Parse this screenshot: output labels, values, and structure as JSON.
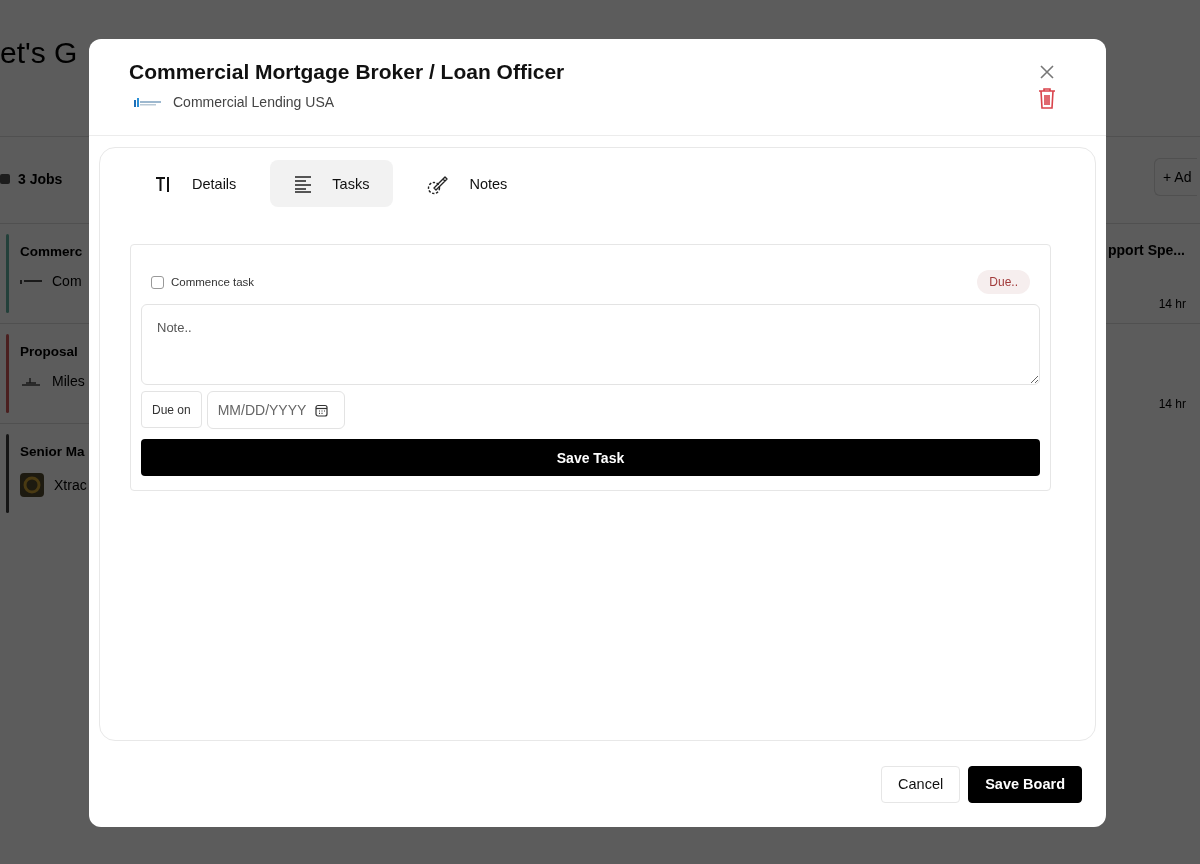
{
  "background": {
    "title": "et's G",
    "jobs_count": "3 Jobs",
    "add_button": "+ Ad",
    "left_cards": [
      {
        "title": "Commerc",
        "company": "Com",
        "color": "#23403a",
        "kind": "wordmark"
      },
      {
        "title": "Proposal",
        "company": "Miles",
        "color": "#4a1f1f",
        "kind": "emblem"
      },
      {
        "title": "Senior Ma",
        "company": "Xtrac",
        "color": "#151515",
        "kind": "badge"
      }
    ],
    "right_cards": [
      {
        "title": "pport Spe...",
        "time": "14 hr"
      },
      {
        "time": "14 hr"
      }
    ]
  },
  "modal": {
    "title": "Commercial Mortgage Broker / Loan Officer",
    "company": "Commercial Lending USA",
    "tabs": [
      {
        "label": "Details",
        "kind": "text",
        "selected": false
      },
      {
        "label": "Tasks",
        "kind": "list",
        "selected": true
      },
      {
        "label": "Notes",
        "kind": "pen",
        "selected": false
      }
    ],
    "task": {
      "checkbox_label": "Commence task",
      "checked": false,
      "due_badge": "Due..",
      "note_placeholder": "Note..",
      "due_label": "Due on",
      "date_placeholder": "MM/DD/YYYY",
      "save_button": "Save Task"
    },
    "buttons": [
      {
        "label": "Cancel",
        "kind": "secondary"
      },
      {
        "label": "Save Board",
        "kind": "primary"
      }
    ]
  }
}
